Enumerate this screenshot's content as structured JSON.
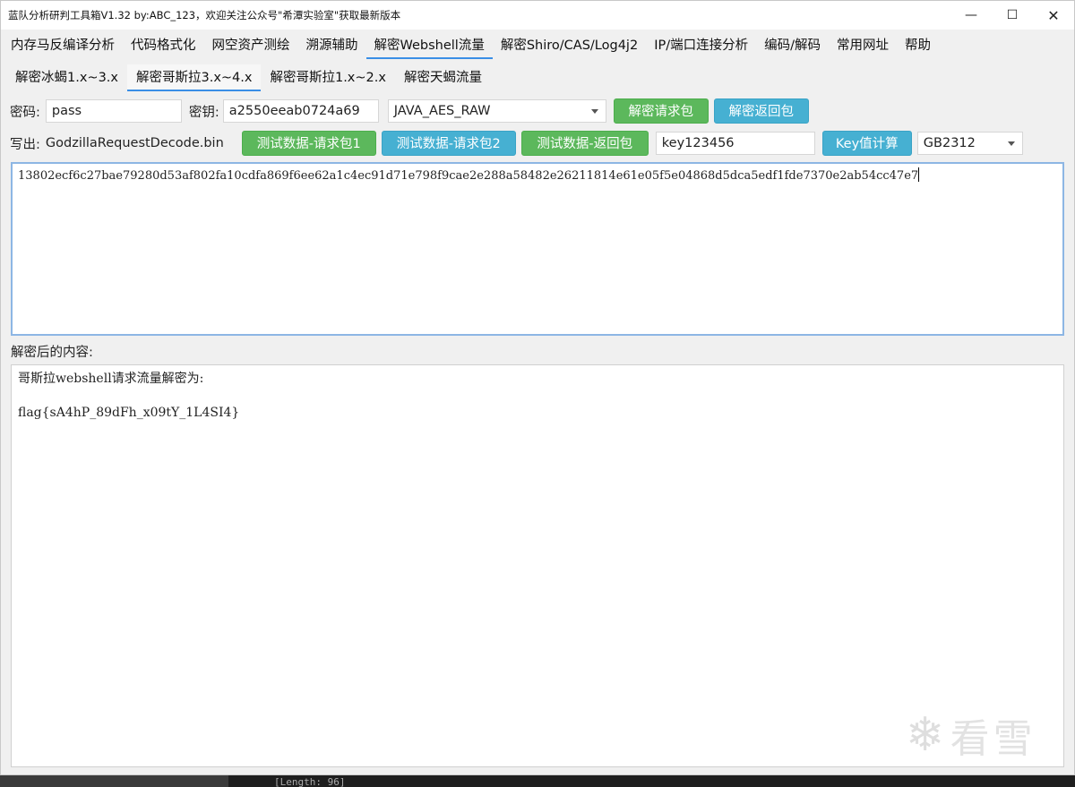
{
  "window": {
    "title": "蓝队分析研判工具箱V1.32 by:ABC_123，欢迎关注公众号\"希潭实验室\"获取最新版本",
    "minimize": "—",
    "maximize": "☐",
    "close": "✕"
  },
  "menu": {
    "items": [
      {
        "label": "内存马反编译分析"
      },
      {
        "label": "代码格式化"
      },
      {
        "label": "网空资产测绘"
      },
      {
        "label": "溯源辅助"
      },
      {
        "label": "解密Webshell流量"
      },
      {
        "label": "解密Shiro/CAS/Log4j2"
      },
      {
        "label": "IP/端口连接分析"
      },
      {
        "label": "编码/解码"
      },
      {
        "label": "常用网址"
      },
      {
        "label": "帮助"
      }
    ],
    "active_index": 4
  },
  "subtabs": {
    "items": [
      {
        "label": "解密冰蝎1.x~3.x"
      },
      {
        "label": "解密哥斯拉3.x~4.x"
      },
      {
        "label": "解密哥斯拉1.x~2.x"
      },
      {
        "label": "解密天蝎流量"
      }
    ],
    "active_index": 1
  },
  "form": {
    "password_label": "密码:",
    "password_value": "pass",
    "key_label": "密钥:",
    "key_value": "a2550eeab0724a69",
    "mode_value": "JAVA_AES_RAW",
    "decrypt_request_button": "解密请求包",
    "decrypt_response_button": "解密返回包",
    "write_out_label": "写出:",
    "write_out_file": "GodzillaRequestDecode.bin",
    "test_request1_button": "测试数据-请求包1",
    "test_request2_button": "测试数据-请求包2",
    "test_response_button": "测试数据-返回包",
    "key_input_value": "key123456",
    "key_calc_button": "Key值计算",
    "charset_value": "GB2312"
  },
  "input_area": {
    "text": "13802ecf6c27bae79280d53af802fa10cdfa869f6ee62a1c4ec91d71e798f9cae2e288a58482e26211814e61e05f5e04868d5dca5edf1fde7370e2ab54cc47e7"
  },
  "output_area": {
    "label": "解密后的内容:",
    "line1": "哥斯拉webshell请求流量解密为:",
    "line2": "flag{sA4hP_89dFh_x09tY_1L4SI4}"
  },
  "watermark": {
    "text": "看雪"
  },
  "terminal": {
    "text": "[Length: 96]"
  },
  "colors": {
    "green_button": "#5cb85c",
    "blue_button": "#46b0d2",
    "active_tab_underline": "#3a8ee6",
    "input_focus_border": "#8db6e4"
  }
}
